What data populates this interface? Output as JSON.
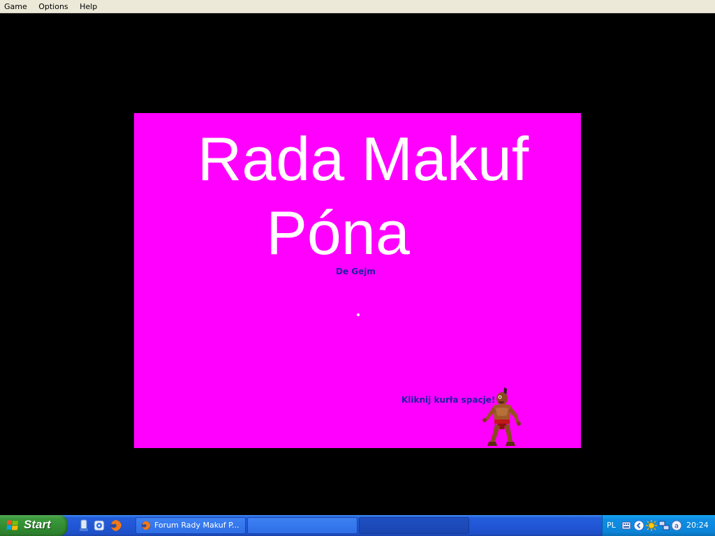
{
  "menu": {
    "items": [
      "Game",
      "Options",
      "Help"
    ]
  },
  "game": {
    "title_line1": "Rada Makuf",
    "title_line2": "Póna",
    "subtitle": "De Gejm",
    "prompt": "Kliknij kurła spacje!",
    "background_color": "#ff00ff",
    "text_color": "#2020a0"
  },
  "taskbar": {
    "start_label": "Start",
    "quick_launch": [
      "show-desktop-icon",
      "media-player-icon",
      "firefox-icon"
    ],
    "tasks": [
      {
        "label": "Forum Rady Makuf P..."
      }
    ],
    "tray": {
      "language": "PL",
      "clock": "20:24"
    }
  }
}
